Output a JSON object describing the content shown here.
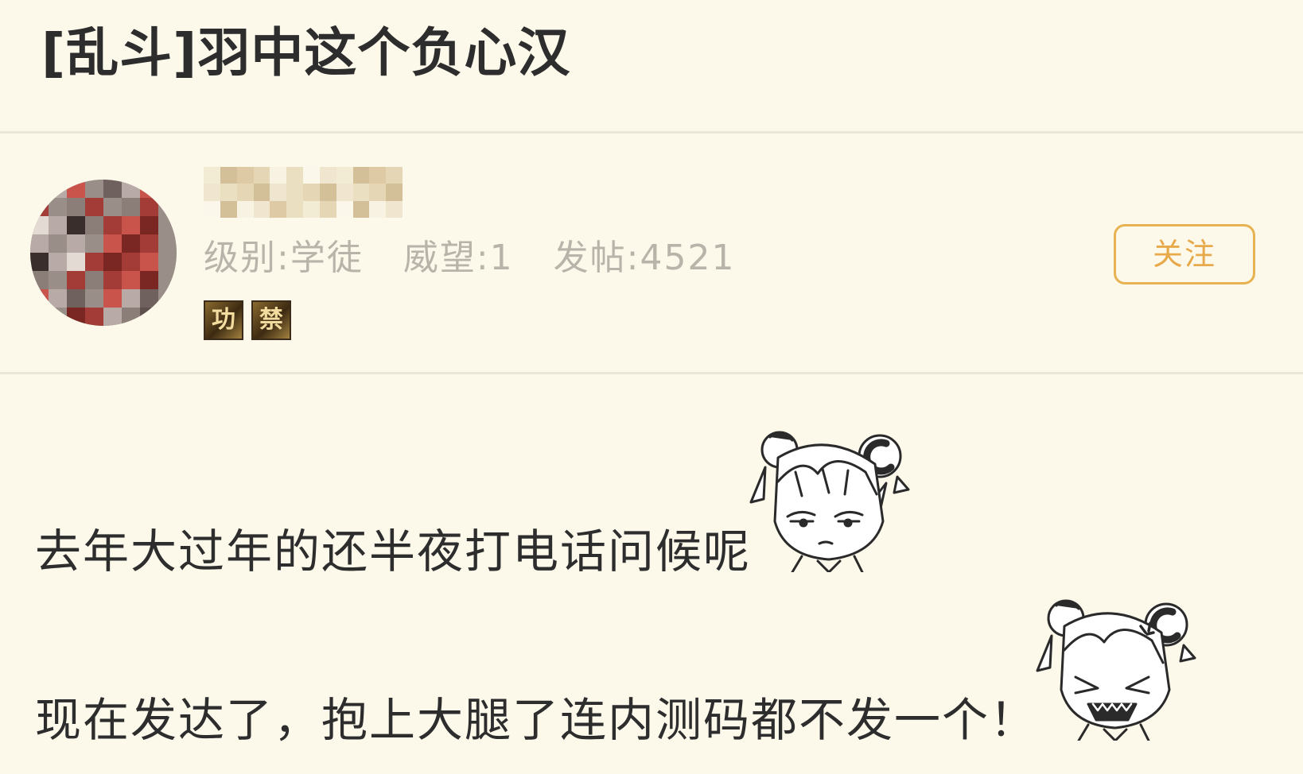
{
  "post": {
    "title": "[乱斗]羽中这个负心汉"
  },
  "author": {
    "meta": {
      "level": "级别:学徒",
      "reputation": "威望:1",
      "posts": "发帖:4521"
    },
    "badges": [
      {
        "glyph": "功",
        "icon": "medal-badge-icon"
      },
      {
        "glyph": "禁",
        "icon": "medal-badge-icon"
      }
    ],
    "follow_label": "关注"
  },
  "content": {
    "line1": "去年大过年的还半夜打电话问候呢",
    "line2": "现在发达了，抱上大腿了连内测码都不发一个！",
    "stickers": [
      "smug-girl-sticker-icon",
      "angry-girl-sticker-icon"
    ]
  },
  "colors": {
    "background": "#fcf8ea",
    "divider": "#ece6d6",
    "accent": "#e7b352",
    "meta_text": "#b9b4aa",
    "body_text": "#2d2d2d"
  }
}
